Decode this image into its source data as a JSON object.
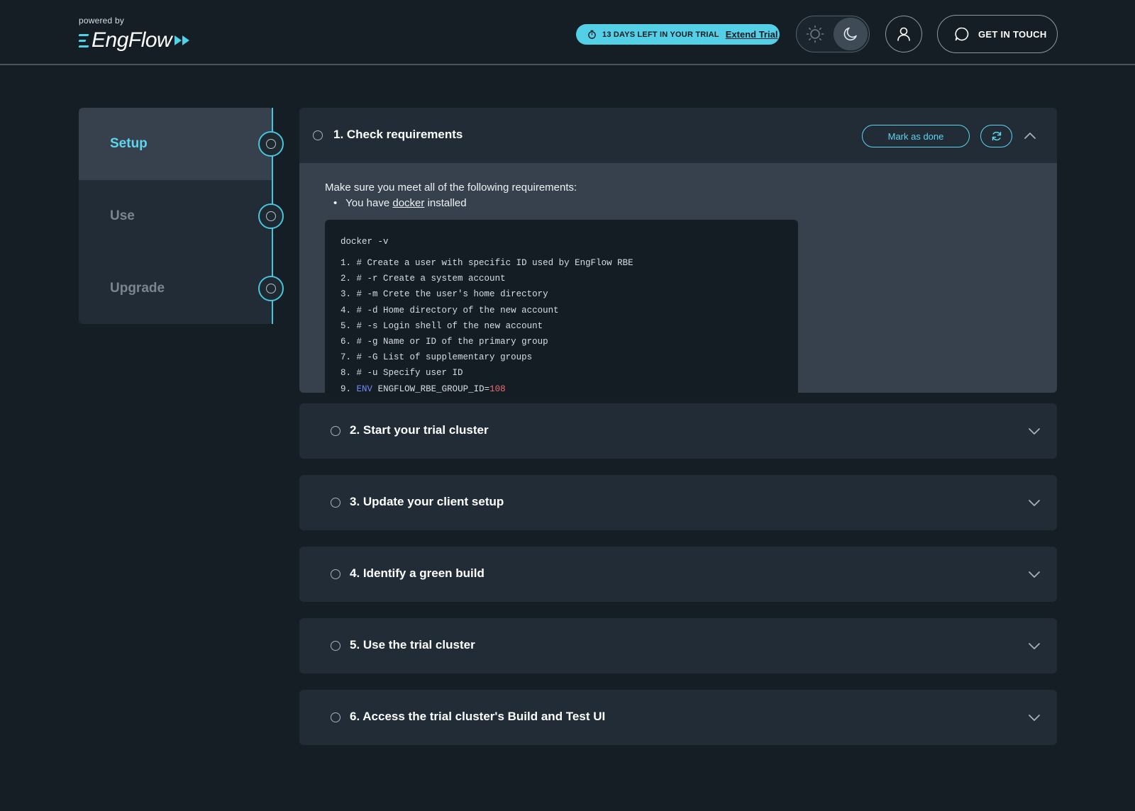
{
  "header": {
    "powered_by": "powered by",
    "logo_text": "EngFlow",
    "trial_text": "13 DAYS LEFT IN YOUR TRIAL",
    "extend_label": "Extend Trial",
    "contact_label": "GET IN TOUCH"
  },
  "sidebar": {
    "items": [
      {
        "label": "Setup",
        "active": true
      },
      {
        "label": "Use",
        "active": false
      },
      {
        "label": "Upgrade",
        "active": false
      }
    ]
  },
  "steps": [
    {
      "title": "1. Check requirements",
      "expanded": true,
      "mark_done_label": "Mark as done",
      "intro": "Make sure you meet all of the following requirements:",
      "requirement_prefix": "You have",
      "requirement_link": "docker",
      "requirement_suffix": "installed",
      "code_command": "docker -v",
      "code_lines": [
        {
          "num": "1.",
          "text": "# Create a user with specific ID used by EngFlow RBE"
        },
        {
          "num": "2.",
          "text": "# -r Create a system account"
        },
        {
          "num": "3.",
          "text": "# -m Crete the user's home directory"
        },
        {
          "num": "4.",
          "text": "# -d Home directory of the new account"
        },
        {
          "num": "5.",
          "text": "# -s Login shell of the new account"
        },
        {
          "num": "6.",
          "text": "# -g Name or ID of the primary group"
        },
        {
          "num": "7.",
          "text": "# -G List of supplementary groups"
        },
        {
          "num": "8.",
          "text": "# -u Specify user ID"
        },
        {
          "num": "9.",
          "keyword": "ENV",
          "text": "ENGFLOW_RBE_GROUP_ID=",
          "value": "108"
        }
      ]
    },
    {
      "title": "2. Start your trial cluster",
      "expanded": false
    },
    {
      "title": "3. Update your client setup",
      "expanded": false
    },
    {
      "title": "4. Identify a green build",
      "expanded": false
    },
    {
      "title": "5. Use the trial cluster",
      "expanded": false
    },
    {
      "title": "6. Access the trial cluster's Build and Test UI",
      "expanded": false
    }
  ],
  "icons": {
    "timer": "stopwatch-icon",
    "sun": "sun-icon",
    "moon": "moon-icon",
    "user": "user-icon",
    "chat": "chat-bubble-icon",
    "refresh": "refresh-icon",
    "chevron_up": "chevron-up-icon",
    "chevron_down": "chevron-down-icon"
  },
  "colors": {
    "accent": "#5fd4ee",
    "background": "#161e25",
    "panel": "#212c36",
    "panel_expanded": "#36414d",
    "code_bg": "#151d24",
    "code_keyword": "#6e8cf5",
    "code_number": "#f06c6c"
  }
}
